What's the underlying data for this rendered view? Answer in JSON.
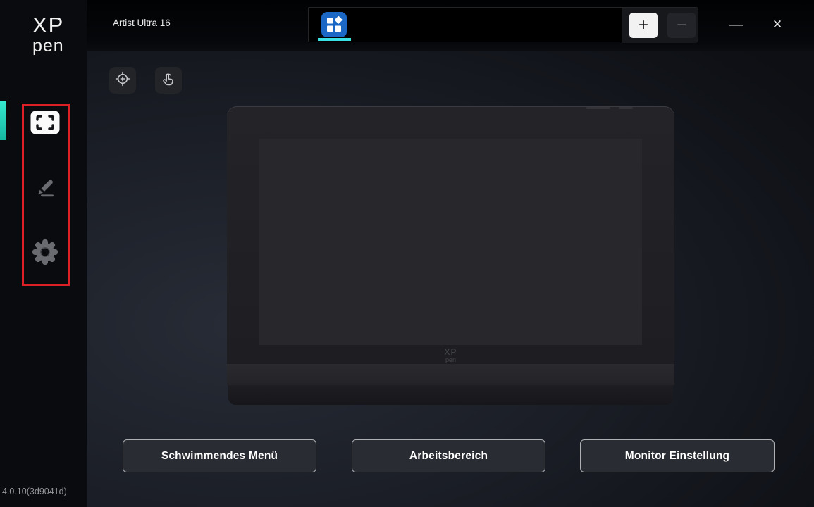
{
  "colors": {
    "accent_cyan_underline": "#3BE1E4",
    "tab_icon_blue": "#1A67C6",
    "annotation_red": "#DD1F26",
    "sidebar_active_teal": "#2FE5C8"
  },
  "sidebar": {
    "logo": {
      "line1": "XP",
      "line2": "pen"
    },
    "items": [
      {
        "id": "work-area",
        "icon": "display-area-icon",
        "active": true
      },
      {
        "id": "pen-settings",
        "icon": "pen-icon",
        "active": false
      },
      {
        "id": "app-settings",
        "icon": "gear-icon",
        "active": false
      }
    ],
    "version": "4.0.10(3d9041d)"
  },
  "header": {
    "device_name": "Artist Ultra 16",
    "tab": {
      "icon": "apps-grid-icon",
      "active": true
    },
    "add_tab_label": "+",
    "remove_tab_label": "−",
    "minimize_label": "—",
    "close_label": "✕"
  },
  "toolbar": {
    "buttons": [
      {
        "id": "calibration",
        "icon": "crosshair-icon"
      },
      {
        "id": "touch-setting",
        "icon": "touch-tap-icon"
      }
    ]
  },
  "tablet_preview": {
    "logo_line1": "XP",
    "logo_line2": "pen"
  },
  "actions": [
    {
      "label": "Schwimmendes Menü"
    },
    {
      "label": "Arbeitsbereich"
    },
    {
      "label": "Monitor Einstellung"
    }
  ]
}
